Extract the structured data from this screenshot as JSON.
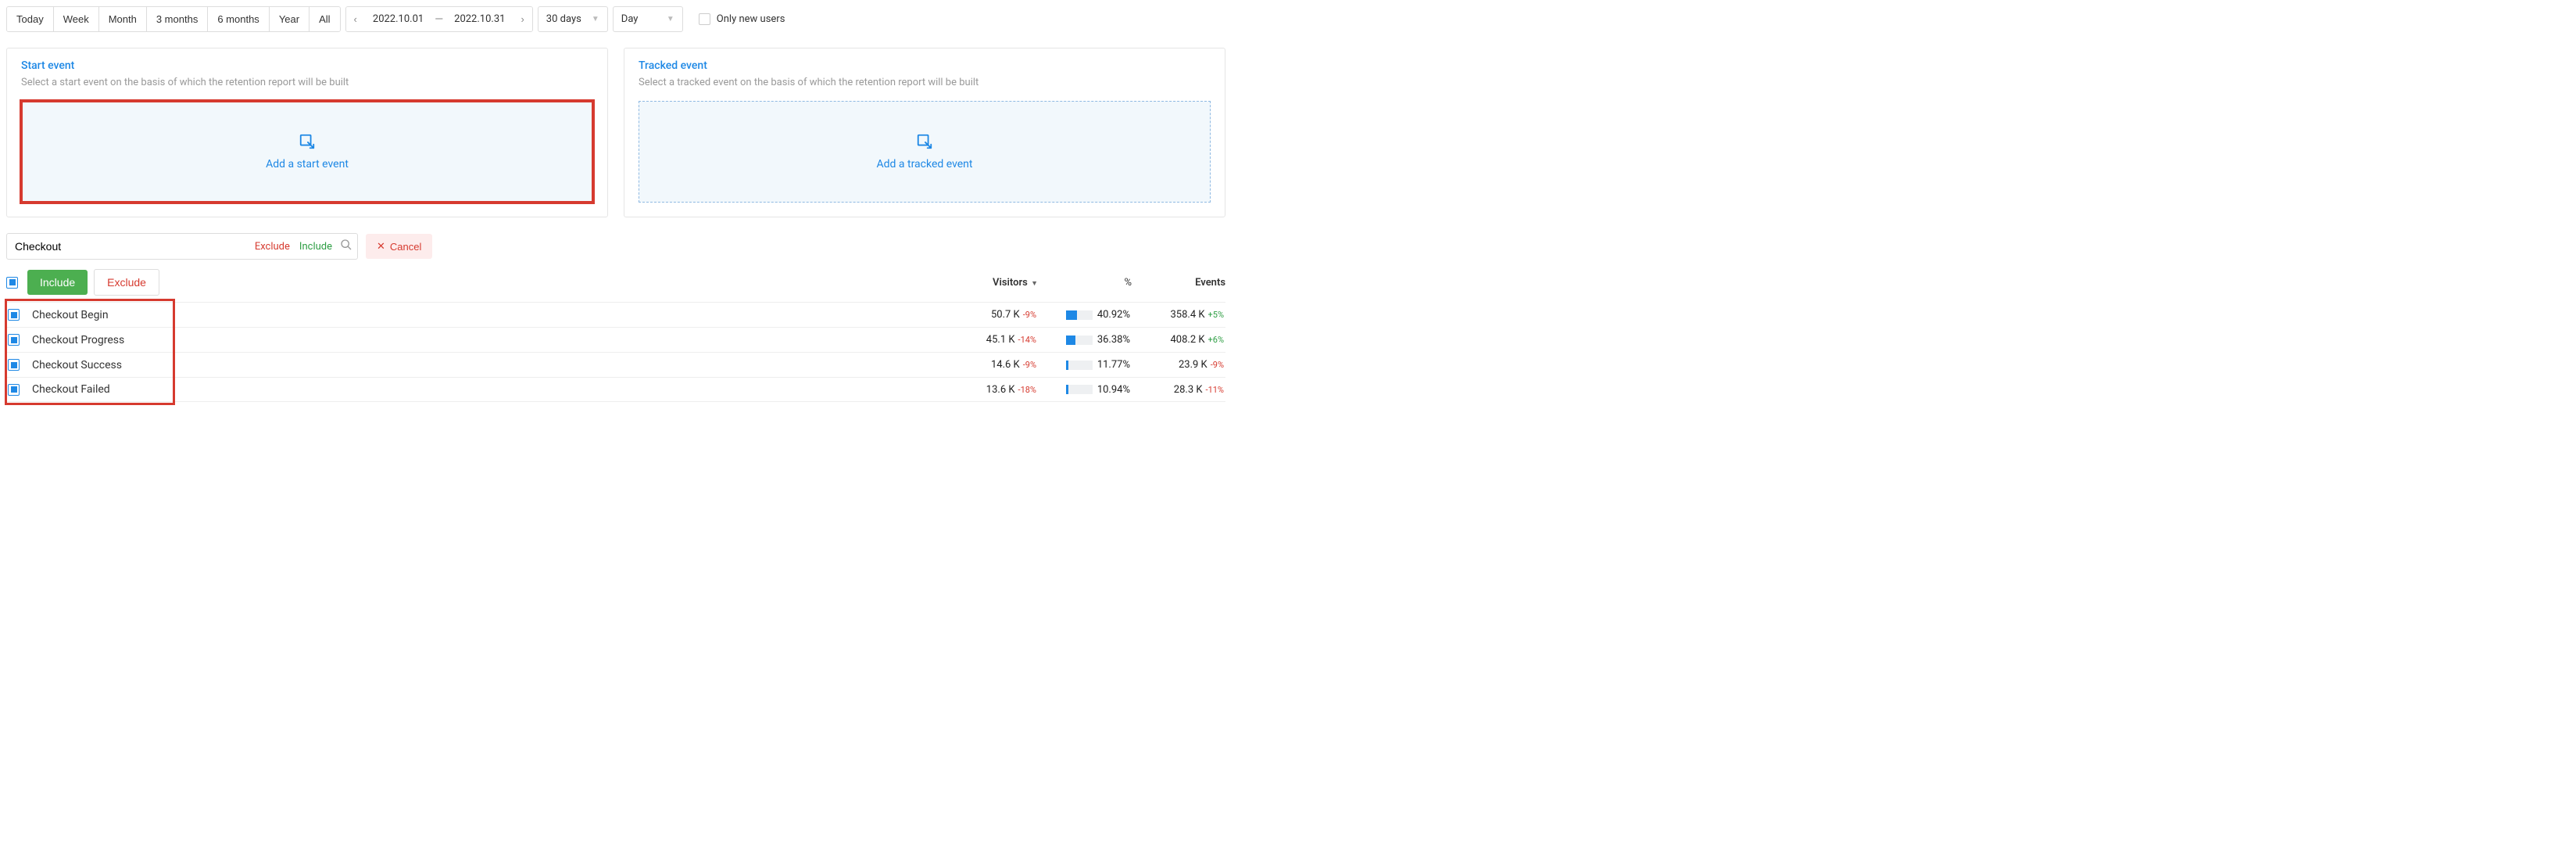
{
  "toolbar": {
    "periods": [
      "Today",
      "Week",
      "Month",
      "3 months",
      "6 months",
      "Year",
      "All"
    ],
    "date_from": "2022.10.01",
    "date_to": "2022.10.31",
    "range_label": "30 days",
    "granularity": "Day",
    "only_new_users_label": "Only new users"
  },
  "panels": {
    "start": {
      "title": "Start event",
      "subtitle": "Select a start event on the basis of which the retention report will be built",
      "cta": "Add a start event"
    },
    "tracked": {
      "title": "Tracked event",
      "subtitle": "Select a tracked event on the basis of which the retention report will be built",
      "cta": "Add a tracked event"
    }
  },
  "search": {
    "value": "Checkout",
    "exclude_label": "Exclude",
    "include_label": "Include",
    "cancel_label": "Cancel"
  },
  "actions": {
    "include": "Include",
    "exclude": "Exclude"
  },
  "columns": {
    "visitors": "Visitors",
    "percent": "%",
    "events": "Events"
  },
  "rows": [
    {
      "name": "Checkout Begin",
      "visitors": "50.7 K",
      "v_delta": "-9%",
      "pct": "40.92%",
      "bar": 41,
      "events": "358.4 K",
      "e_delta": "+5%",
      "e_pos": true
    },
    {
      "name": "Checkout Progress",
      "visitors": "45.1 K",
      "v_delta": "-14%",
      "pct": "36.38%",
      "bar": 36,
      "events": "408.2 K",
      "e_delta": "+6%",
      "e_pos": true
    },
    {
      "name": "Checkout Success",
      "visitors": "14.6 K",
      "v_delta": "-9%",
      "pct": "11.77%",
      "bar": 9,
      "events": "23.9 K",
      "e_delta": "-9%",
      "e_pos": false
    },
    {
      "name": "Checkout Failed",
      "visitors": "13.6 K",
      "v_delta": "-18%",
      "pct": "10.94%",
      "bar": 9,
      "events": "28.3 K",
      "e_delta": "-11%",
      "e_pos": false
    }
  ]
}
